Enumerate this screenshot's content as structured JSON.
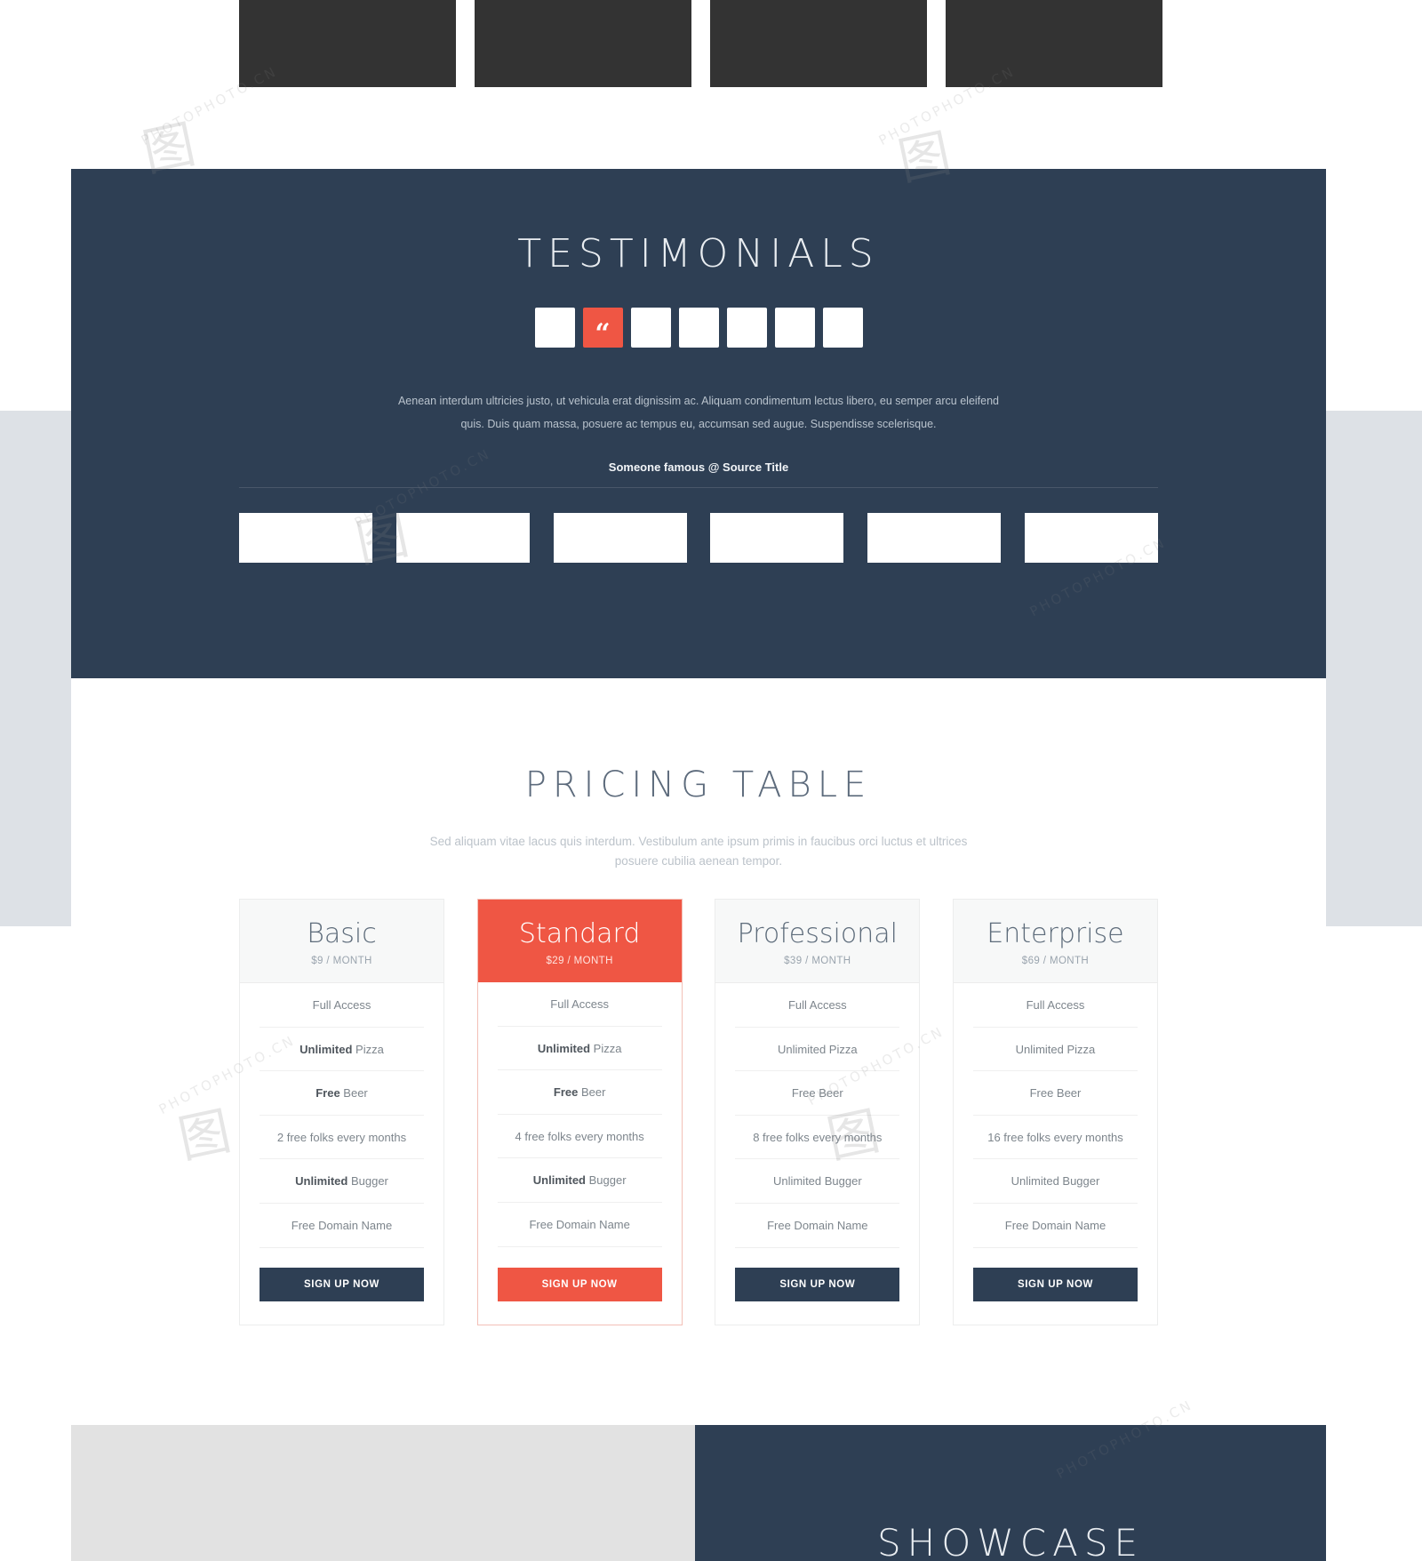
{
  "colors": {
    "navy": "#2e3f54",
    "accent_red": "#ef5644",
    "page_white": "#ffffff",
    "band_gray": "#dde1e6",
    "footer_gray": "#e2e2e2",
    "thumb_dark": "#333333",
    "muted_text": "#bcc3ca"
  },
  "thumbnails": {
    "items": [
      "thumbnail-1",
      "thumbnail-2",
      "thumbnail-3",
      "thumbnail-4"
    ]
  },
  "testimonials": {
    "title": "TESTIMONIALS",
    "avatars": [
      {
        "id": "avatar-1",
        "active": false,
        "icon": ""
      },
      {
        "id": "avatar-2",
        "active": true,
        "icon": "quote-icon"
      },
      {
        "id": "avatar-3",
        "active": false,
        "icon": ""
      },
      {
        "id": "avatar-4",
        "active": false,
        "icon": ""
      },
      {
        "id": "avatar-5",
        "active": false,
        "icon": ""
      },
      {
        "id": "avatar-6",
        "active": false,
        "icon": ""
      },
      {
        "id": "avatar-7",
        "active": false,
        "icon": ""
      }
    ],
    "quote_glyph": "“",
    "quote": "Aenean interdum ultricies justo, ut vehicula erat dignissim ac. Aliquam condimentum lectus libero, eu semper arcu eleifend quis. Duis quam massa, posuere ac tempus eu, accumsan sed augue. Suspendisse scelerisque.",
    "source": "Someone famous @ Source Title",
    "clients": [
      "client-logo-1",
      "client-logo-2",
      "client-logo-3",
      "client-logo-4",
      "client-logo-5",
      "client-logo-6"
    ]
  },
  "pricing": {
    "title": "PRICING TABLE",
    "subtitle": "Sed aliquam vitae lacus quis interdum. Vestibulum ante ipsum primis in faucibus orci luctus et ultrices posuere cubilia aenean tempor.",
    "signup_label": "SIGN UP NOW",
    "plans": [
      {
        "name": "Basic",
        "price": "$9 / MONTH",
        "featured": false,
        "features": [
          {
            "strong": "",
            "text": "Full Access"
          },
          {
            "strong": "Unlimited",
            "text": " Pizza"
          },
          {
            "strong": "Free",
            "text": " Beer"
          },
          {
            "strong": "",
            "text": "2 free folks every months"
          },
          {
            "strong": "Unlimited",
            "text": " Bugger"
          },
          {
            "strong": "",
            "text": "Free Domain Name"
          }
        ]
      },
      {
        "name": "Standard",
        "price": "$29 / MONTH",
        "featured": true,
        "features": [
          {
            "strong": "",
            "text": "Full Access"
          },
          {
            "strong": "Unlimited",
            "text": " Pizza"
          },
          {
            "strong": "Free",
            "text": " Beer"
          },
          {
            "strong": "",
            "text": "4 free folks every months"
          },
          {
            "strong": "Unlimited",
            "text": " Bugger"
          },
          {
            "strong": "",
            "text": "Free Domain Name"
          }
        ]
      },
      {
        "name": "Professional",
        "price": "$39 / MONTH",
        "featured": false,
        "features": [
          {
            "strong": "",
            "text": "Full Access"
          },
          {
            "strong": "",
            "text": "Unlimited Pizza"
          },
          {
            "strong": "",
            "text": "Free Beer"
          },
          {
            "strong": "",
            "text": "8 free folks every months"
          },
          {
            "strong": "",
            "text": "Unlimited Bugger"
          },
          {
            "strong": "",
            "text": "Free Domain Name"
          }
        ]
      },
      {
        "name": "Enterprise",
        "price": "$69 / MONTH",
        "featured": false,
        "features": [
          {
            "strong": "",
            "text": "Full Access"
          },
          {
            "strong": "",
            "text": "Unlimited Pizza"
          },
          {
            "strong": "",
            "text": "Free Beer"
          },
          {
            "strong": "",
            "text": "16 free folks every months"
          },
          {
            "strong": "",
            "text": "Unlimited Bugger"
          },
          {
            "strong": "",
            "text": "Free Domain Name"
          }
        ]
      }
    ]
  },
  "showcase": {
    "title": "SHOWCASE"
  },
  "watermarks": {
    "text": "PHOTOPHOTO.CN",
    "mark": "图"
  }
}
